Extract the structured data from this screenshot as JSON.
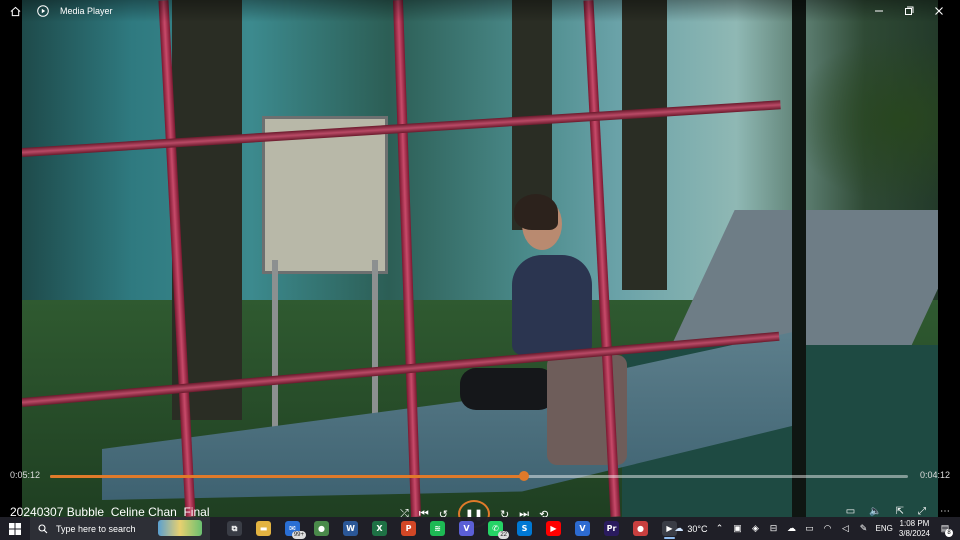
{
  "window": {
    "title": "Media Player"
  },
  "player": {
    "elapsed": "0:05:12",
    "remaining": "0:04:12",
    "progress_fraction": 0.553,
    "media_title": "20240307 Bubble_Celine Chan_Final",
    "play_state_icon": "pause-icon"
  },
  "taskbar": {
    "search_placeholder": "Type here to search",
    "apps": [
      {
        "name": "task-view",
        "glyph": "⧉",
        "color": "#3a3d46",
        "badge": ""
      },
      {
        "name": "file-explorer",
        "glyph": "▬",
        "color": "#e3b341",
        "badge": ""
      },
      {
        "name": "mail",
        "glyph": "✉",
        "color": "#2a6fd4",
        "badge": "99+"
      },
      {
        "name": "chrome",
        "glyph": "●",
        "color": "#4a8a4a",
        "badge": ""
      },
      {
        "name": "word",
        "glyph": "W",
        "color": "#2b5797",
        "badge": ""
      },
      {
        "name": "excel",
        "glyph": "X",
        "color": "#1e7145",
        "badge": ""
      },
      {
        "name": "powerpoint",
        "glyph": "P",
        "color": "#d24726",
        "badge": ""
      },
      {
        "name": "spotify",
        "glyph": "≋",
        "color": "#1db954",
        "badge": ""
      },
      {
        "name": "vpn",
        "glyph": "V",
        "color": "#5b5fd6",
        "badge": ""
      },
      {
        "name": "whatsapp",
        "glyph": "✆",
        "color": "#25d366",
        "badge": "22"
      },
      {
        "name": "skype",
        "glyph": "S",
        "color": "#0078d4",
        "badge": ""
      },
      {
        "name": "youtube",
        "glyph": "▶",
        "color": "#ff0000",
        "badge": ""
      },
      {
        "name": "vegas",
        "glyph": "V",
        "color": "#2d6bd1",
        "badge": ""
      },
      {
        "name": "premiere",
        "glyph": "Pr",
        "color": "#2a1b5e",
        "badge": ""
      },
      {
        "name": "chrome-2",
        "glyph": "●",
        "color": "#c83f3f",
        "badge": ""
      },
      {
        "name": "media-player",
        "glyph": "▶",
        "color": "#3a3d46",
        "badge": ""
      }
    ],
    "weather": "30°C",
    "language": "ENG",
    "time": "1:08 PM",
    "date": "3/8/2024",
    "notification_count": "8"
  }
}
